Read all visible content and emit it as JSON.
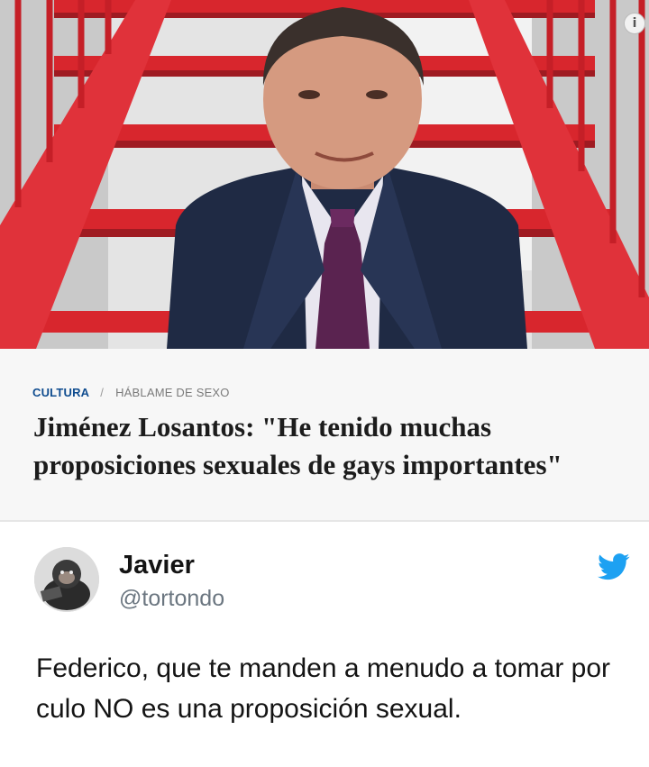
{
  "article": {
    "section": "CULTURA",
    "separator": "/",
    "subsection": "HÁBLAME DE SEXO",
    "headline": "Jiménez Losantos: \"He tenido muchas proposiciones sexuales de gays importantes\""
  },
  "photo_badge": "i",
  "tweet": {
    "display_name": "Javier",
    "handle": "@tortondo",
    "text": "Federico, que te manden a menudo a tomar por culo NO es una proposición sexual."
  },
  "colors": {
    "section_blue": "#0f4c8f",
    "twitter_blue": "#1da1f2",
    "stair_red": "#d8262d"
  },
  "icons": [
    "info-icon",
    "twitter-bird-icon"
  ]
}
